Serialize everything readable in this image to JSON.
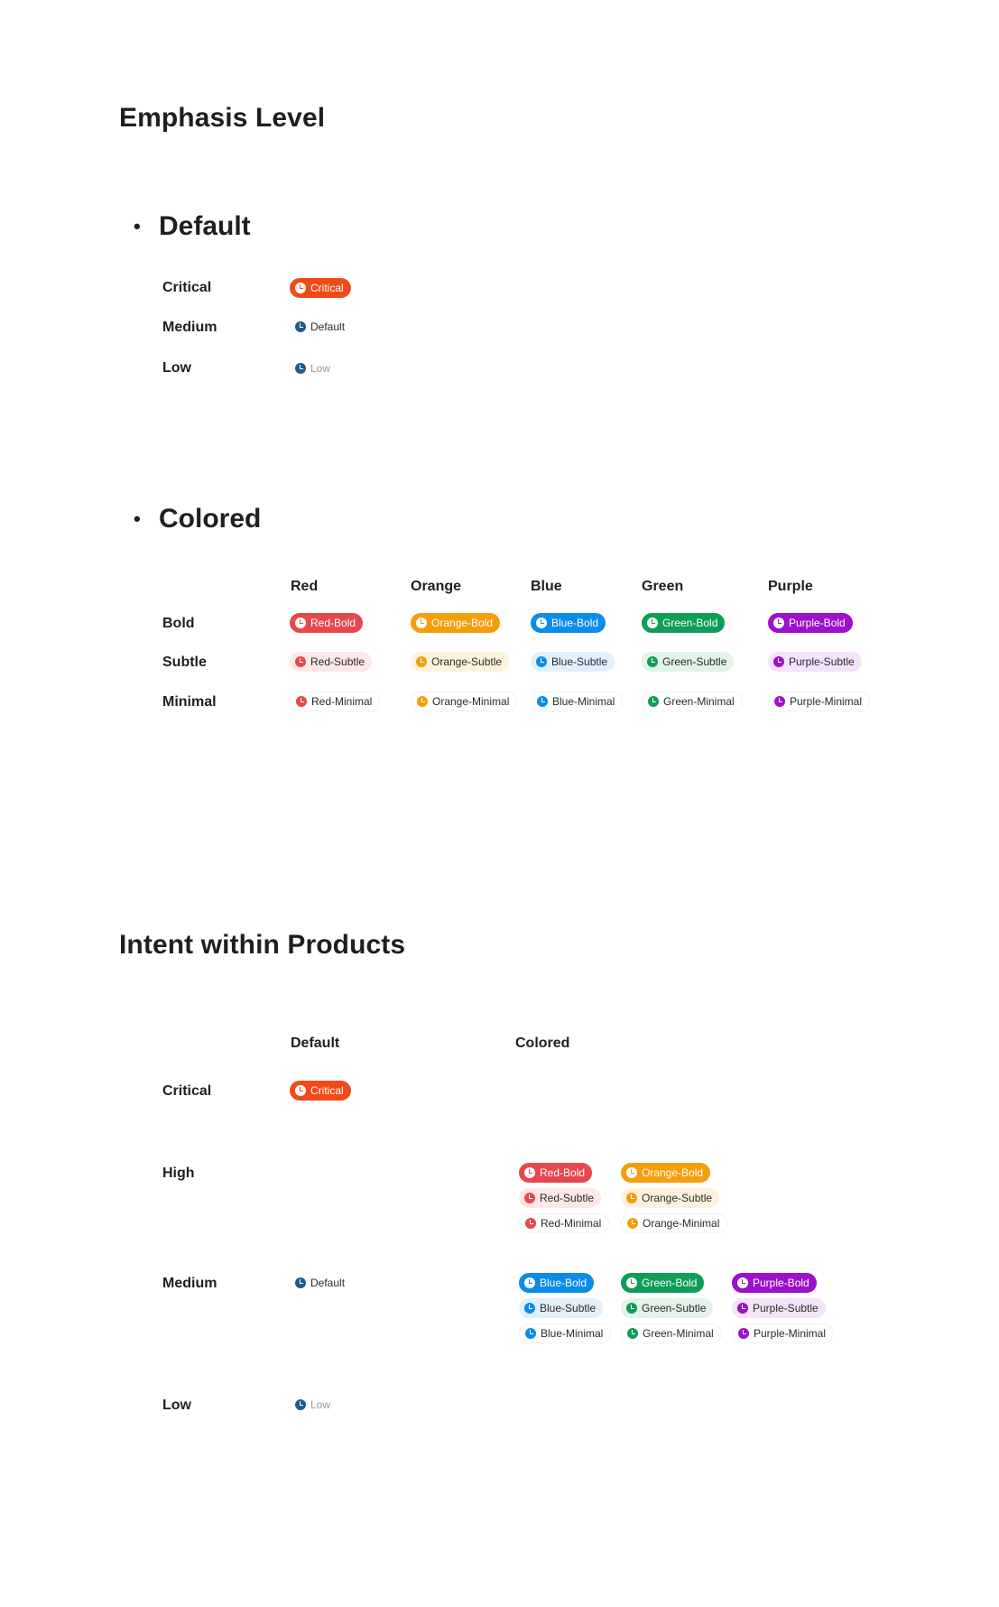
{
  "emphasis": {
    "title": "Emphasis Level",
    "bullet": "•",
    "default_section": {
      "heading": "Default",
      "rows": [
        {
          "label": "Critical",
          "tag": "Critical"
        },
        {
          "label": "Medium",
          "tag": "Default"
        },
        {
          "label": "Low",
          "tag": "Low"
        }
      ]
    },
    "colored_section": {
      "heading": "Colored",
      "columns": [
        "Red",
        "Orange",
        "Blue",
        "Green",
        "Purple"
      ],
      "rows": [
        "Bold",
        "Subtle",
        "Minimal"
      ],
      "tags": {
        "red": [
          "Red-Bold",
          "Red-Subtle",
          "Red-Minimal"
        ],
        "orange": [
          "Orange-Bold",
          "Orange-Subtle",
          "Orange-Minimal"
        ],
        "blue": [
          "Blue-Bold",
          "Blue-Subtle",
          "Blue-Minimal"
        ],
        "green": [
          "Green-Bold",
          "Green-Subtle",
          "Green-Minimal"
        ],
        "purple": [
          "Purple-Bold",
          "Purple-Subtle",
          "Purple-Minimal"
        ]
      }
    }
  },
  "intent": {
    "title": "Intent within Products",
    "columns": {
      "default": "Default",
      "colored": "Colored"
    },
    "rows": {
      "critical": "Critical",
      "high": "High",
      "medium": "Medium",
      "low": "Low"
    },
    "default_tags": {
      "critical": "Critical",
      "medium": "Default",
      "low": "Low"
    },
    "high_tags": {
      "red": [
        "Red-Bold",
        "Red-Subtle",
        "Red-Minimal"
      ],
      "orange": [
        "Orange-Bold",
        "Orange-Subtle",
        "Orange-Minimal"
      ]
    },
    "medium_tags": {
      "blue": [
        "Blue-Bold",
        "Blue-Subtle",
        "Blue-Minimal"
      ],
      "green": [
        "Green-Bold",
        "Green-Subtle",
        "Green-Minimal"
      ],
      "purple": [
        "Purple-Bold",
        "Purple-Subtle",
        "Purple-Minimal"
      ]
    }
  },
  "colors": {
    "critical": "#f04a19",
    "default_icon": "#1f5a8c",
    "red": "#e5484d",
    "orange": "#f59e0b",
    "blue": "#0b8ce9",
    "green": "#0f9d58",
    "purple": "#9c11c9",
    "red_subtle_bg": "#fde8e8",
    "orange_subtle_bg": "#fdf3dc",
    "blue_subtle_bg": "#e2f0fc",
    "green_subtle_bg": "#e2f3ea",
    "purple_subtle_bg": "#f4e3fa"
  }
}
